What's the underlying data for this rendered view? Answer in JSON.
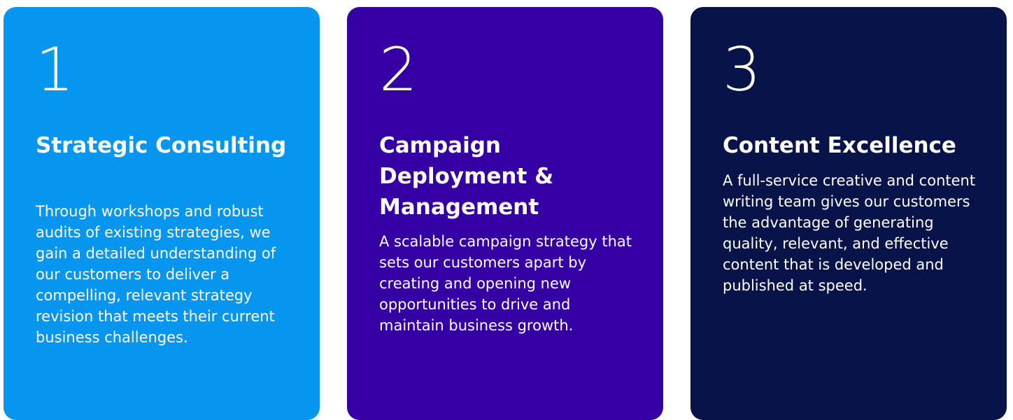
{
  "cards": [
    {
      "number": "1",
      "title": "Strategic Consulting",
      "description": "Through workshops and robust audits of existing strategies, we gain a detailed understanding of our customers to deliver a compelling, relevant strategy revision that meets their current business challenges.",
      "color": "#0796ef"
    },
    {
      "number": "2",
      "title": "Campaign Deployment & Management",
      "description": "A scalable campaign strategy that sets our customers apart by creating and opening new opportunities to drive and maintain business growth.",
      "color": "#3500a3"
    },
    {
      "number": "3",
      "title": "Content Excellence",
      "description": "A full-service creative and content writing team gives our customers the advantage of generating quality, relevant, and effective content that is developed and published at speed.",
      "color": "#081449"
    }
  ]
}
